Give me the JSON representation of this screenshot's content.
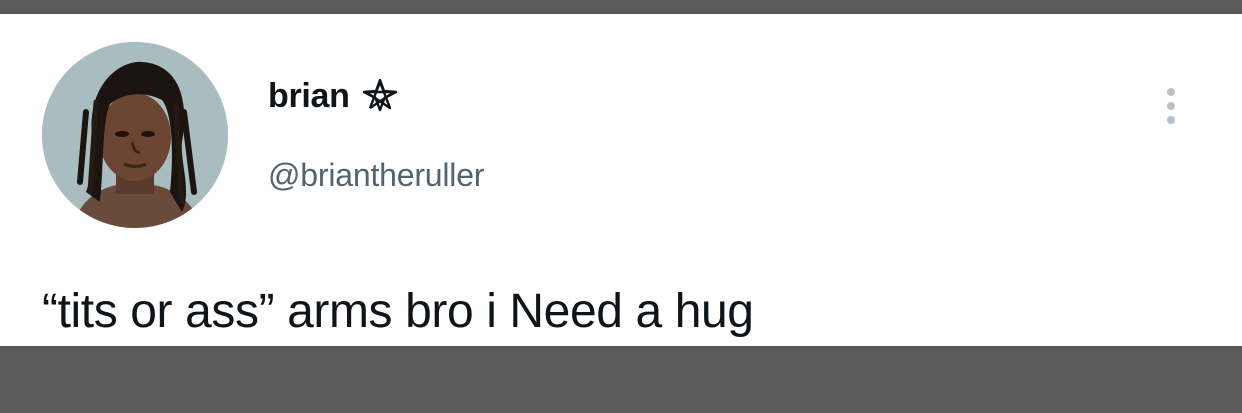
{
  "tweet": {
    "author": {
      "display_name": "brian",
      "name_emoji": "pentagram-icon",
      "handle": "@briantheruller",
      "avatar": "profile-photo"
    },
    "text": "“tits or ass” arms bro i Need a hug",
    "more_icon": "more-options-icon"
  },
  "colors": {
    "background_frame": "#5a5a5a",
    "card": "#ffffff",
    "primary_text": "#0f1419",
    "secondary_text": "#536471",
    "more_dots": "#b9c1c8"
  }
}
